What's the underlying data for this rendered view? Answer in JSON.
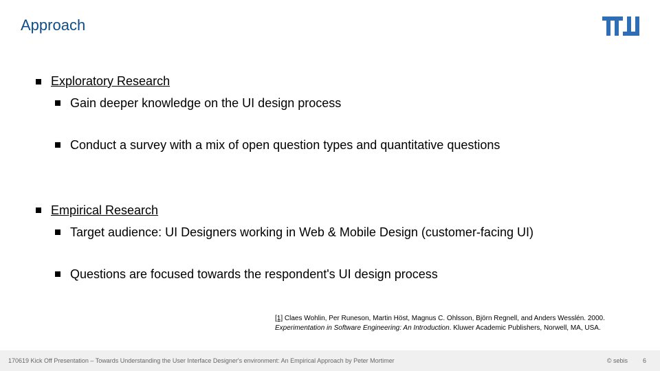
{
  "title": "Approach",
  "sections": [
    {
      "heading": "Exploratory Research",
      "items": [
        "Gain deeper knowledge on the UI design process",
        "Conduct a survey with a mix of open question types and quantitative questions"
      ]
    },
    {
      "heading": "Empirical Research",
      "items": [
        "Target audience: UI Designers working in Web & Mobile Design (customer-facing UI)",
        " Questions are focused towards the respondent's UI design process"
      ]
    }
  ],
  "reference": {
    "link": "[1]",
    "line1": " Claes Wohlin, Per Runeson, Martin Höst, Magnus C. Ohlsson, Björn Regnell, and Anders Wesslén. 2000. ",
    "italic": "Experimentation in Software Engineering: An Introduction",
    "line2": ". Kluwer Academic Publishers, Norwell, MA, USA."
  },
  "footer": {
    "left": "170619 Kick Off Presentation – Towards Understanding the User Interface Designer's environment: An Empirical Approach by  Peter Mortimer",
    "copyright": "© sebis",
    "page": "6"
  }
}
